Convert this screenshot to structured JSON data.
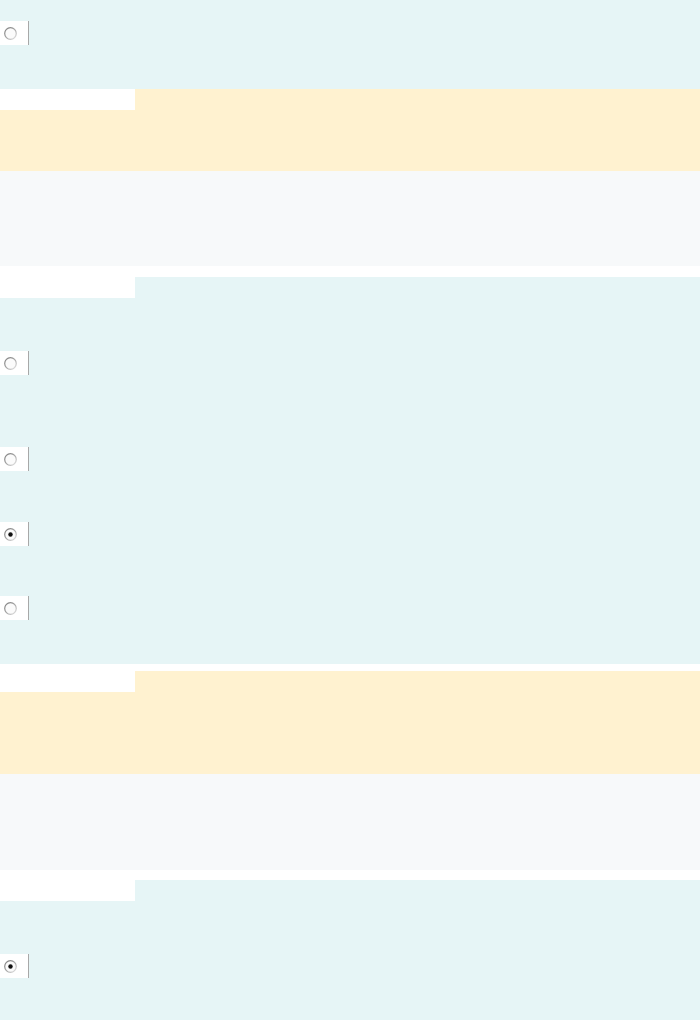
{
  "sections": [
    {
      "kind": "options",
      "options": [
        {
          "selected": false
        }
      ]
    },
    {
      "kind": "highlight"
    },
    {
      "kind": "plain"
    },
    {
      "kind": "options",
      "options": [
        {
          "selected": false
        },
        {
          "selected": false
        },
        {
          "selected": true
        },
        {
          "selected": false
        }
      ]
    },
    {
      "kind": "highlight"
    },
    {
      "kind": "plain"
    },
    {
      "kind": "options",
      "options": [
        {
          "selected": true
        }
      ]
    }
  ]
}
